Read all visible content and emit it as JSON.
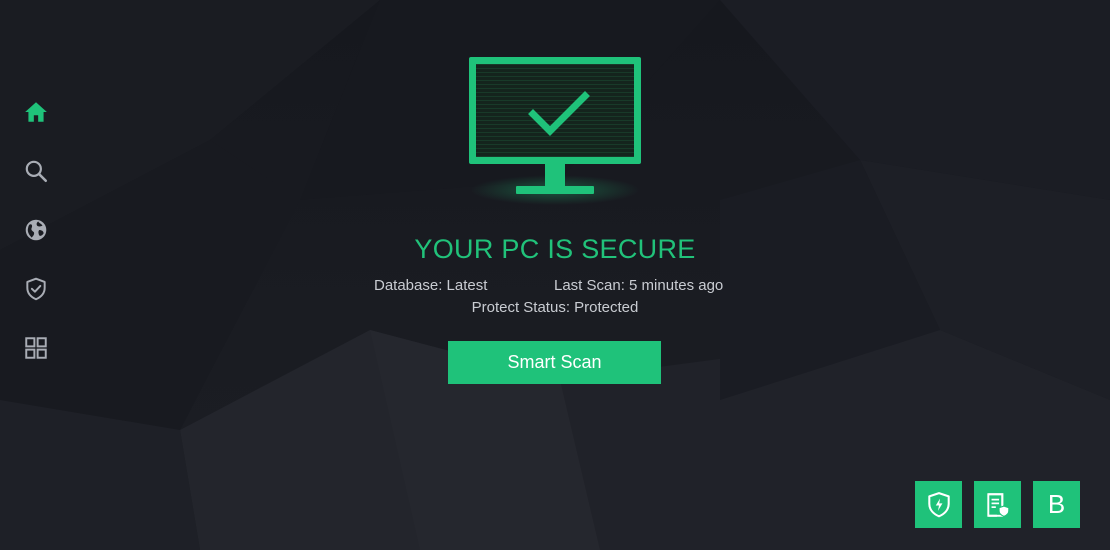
{
  "sidebar": {
    "items": [
      {
        "id": "home",
        "icon": "home-icon",
        "active": true
      },
      {
        "id": "scan",
        "icon": "search-icon",
        "active": false
      },
      {
        "id": "browser",
        "icon": "globe-icon",
        "active": false
      },
      {
        "id": "protection",
        "icon": "shield-check-icon",
        "active": false
      },
      {
        "id": "tools",
        "icon": "grid-icon",
        "active": false
      }
    ]
  },
  "main": {
    "status_title": "YOUR PC IS SECURE",
    "database": "Database: Latest",
    "last_scan": "Last Scan: 5 minutes ago",
    "protect_status": "Protect Status: Protected",
    "scan_button": "Smart Scan"
  },
  "dock": {
    "items": [
      {
        "icon": "shield-bolt-icon"
      },
      {
        "icon": "document-shield-icon"
      },
      {
        "icon": "b-letter-icon",
        "label": "B"
      }
    ]
  },
  "colors": {
    "accent": "#1fc27a",
    "background": "#16181e",
    "icon_inactive": "#a9adb5"
  }
}
